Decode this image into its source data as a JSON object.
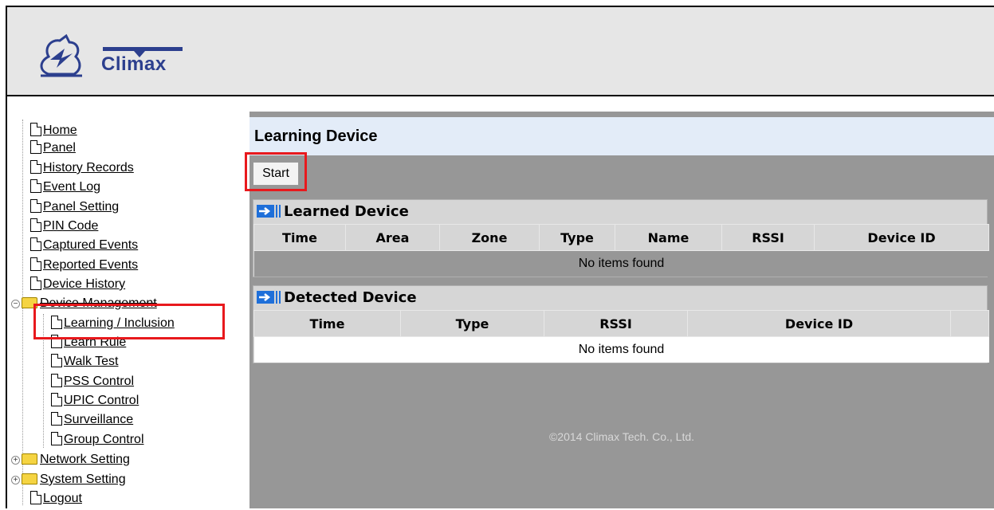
{
  "header": {
    "brand": "Climax"
  },
  "nav": {
    "home": "Home",
    "panel": "Panel",
    "history_records": "History Records",
    "event_log": "Event Log",
    "panel_setting": "Panel Setting",
    "pin_code": "PIN Code",
    "captured_events": "Captured Events",
    "reported_events": "Reported Events",
    "device_history": "Device History",
    "device_management": "Device Management",
    "learning_inclusion": "Learning / Inclusion",
    "learn_rule": "Learn Rule",
    "walk_test": "Walk Test",
    "pss_control": "PSS Control",
    "upic_control": "UPIC Control",
    "surveillance": "Surveillance",
    "group_control": "Group Control",
    "network_setting": "Network Setting",
    "system_setting": "System Setting",
    "logout": "Logout"
  },
  "page": {
    "title": "Learning Device",
    "start_label": "Start",
    "footer": "©2014 Climax Tech. Co., Ltd."
  },
  "learned": {
    "title": "Learned Device",
    "columns": [
      "Time",
      "Area",
      "Zone",
      "Type",
      "Name",
      "RSSI",
      "Device ID"
    ],
    "empty": "No items found"
  },
  "detected": {
    "title": "Detected Device",
    "columns": [
      "Time",
      "Type",
      "RSSI",
      "Device ID",
      ""
    ],
    "empty": "No items found"
  },
  "colors": {
    "highlight": "#e8191d",
    "panel_bg": "#979797",
    "title_bg": "#e3ecf8",
    "brand": "#2c3f8e"
  }
}
